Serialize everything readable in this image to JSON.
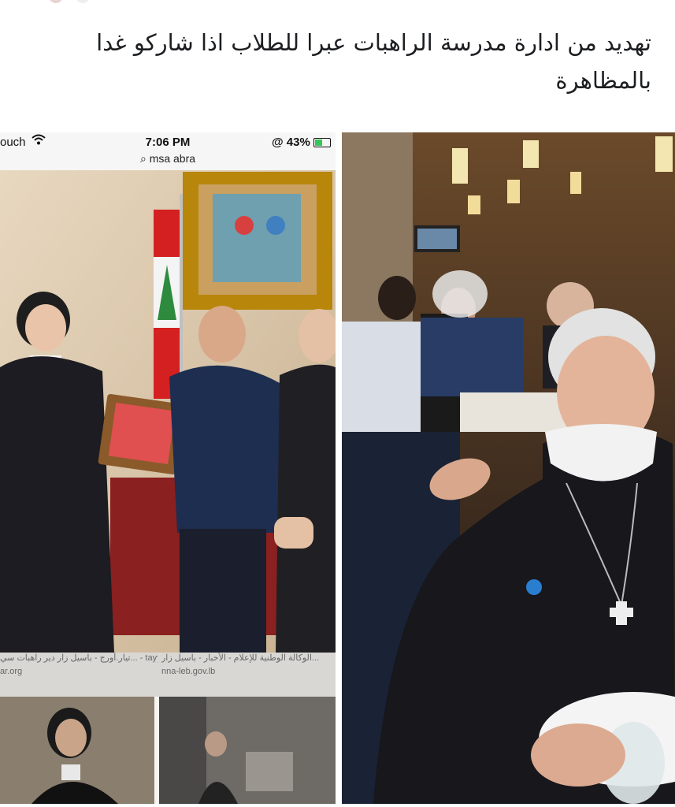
{
  "post": {
    "text_line1": "تهديد من ادارة مدرسة الراهبات عبرا للطلاب اذا شاركو غدا",
    "text_line2": "بالمظاهرة"
  },
  "left_image": {
    "status": {
      "carrier": "ouch",
      "time": "7:06 PM",
      "battery": "@ 43%"
    },
    "url": "msa abra",
    "captions": {
      "cap1": "تيار.أورج - باسيل زار دير راهبات سي... - tayyar.org",
      "cap2": "الوكالة الوطنية للإعلام - الأخبار - باسيل زار...",
      "cap1_domain": "ar.org",
      "cap2_domain": "nna-leb.gov.lb"
    }
  },
  "icons": {
    "wifi": "wifi-icon",
    "search": "search-icon",
    "battery": "battery-icon"
  }
}
